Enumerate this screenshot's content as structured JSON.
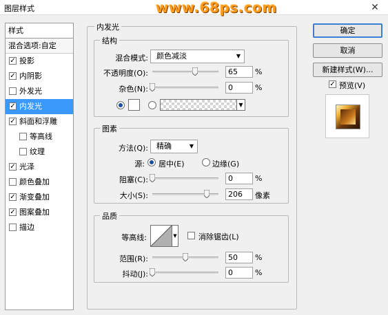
{
  "window": {
    "title": "图层样式",
    "watermark": "www.68ps.com",
    "close_glyph": "✕"
  },
  "left_panel": {
    "header": "样式",
    "blend_options": "混合选项:自定",
    "items": [
      {
        "label": "投影",
        "checked": true,
        "indent": false,
        "selected": false
      },
      {
        "label": "内阴影",
        "checked": true,
        "indent": false,
        "selected": false
      },
      {
        "label": "外发光",
        "checked": false,
        "indent": false,
        "selected": false
      },
      {
        "label": "内发光",
        "checked": true,
        "indent": false,
        "selected": true
      },
      {
        "label": "斜面和浮雕",
        "checked": true,
        "indent": false,
        "selected": false
      },
      {
        "label": "等高线",
        "checked": false,
        "indent": true,
        "selected": false
      },
      {
        "label": "纹理",
        "checked": false,
        "indent": true,
        "selected": false
      },
      {
        "label": "光泽",
        "checked": true,
        "indent": false,
        "selected": false
      },
      {
        "label": "颜色叠加",
        "checked": false,
        "indent": false,
        "selected": false
      },
      {
        "label": "渐变叠加",
        "checked": true,
        "indent": false,
        "selected": false
      },
      {
        "label": "图案叠加",
        "checked": true,
        "indent": false,
        "selected": false
      },
      {
        "label": "描边",
        "checked": false,
        "indent": false,
        "selected": false
      }
    ],
    "check_glyph": "✓"
  },
  "main": {
    "section_title": "内发光",
    "structure": {
      "title": "结构",
      "blend_mode_label": "混合模式:",
      "blend_mode_value": "颜色减淡",
      "opacity_label": "不透明度(O):",
      "opacity_value": "65",
      "opacity_fraction": 0.65,
      "noise_label": "杂色(N):",
      "noise_value": "0",
      "noise_fraction": 0,
      "percent": "%"
    },
    "elements": {
      "title": "图素",
      "method_label": "方法(Q):",
      "method_value": "精确",
      "source_label": "源:",
      "source_center": "居中(E)",
      "source_edge": "边缘(G)",
      "choke_label": "阻塞(C):",
      "choke_value": "0",
      "choke_fraction": 0,
      "size_label": "大小(S):",
      "size_value": "206",
      "size_fraction": 0.825,
      "size_unit": "像素",
      "percent": "%"
    },
    "quality": {
      "title": "品质",
      "contour_label": "等高线:",
      "antialias_label": "消除锯齿(L)",
      "range_label": "范围(R):",
      "range_value": "50",
      "range_fraction": 0.5,
      "jitter_label": "抖动(J):",
      "jitter_value": "0",
      "jitter_fraction": 0,
      "percent": "%"
    }
  },
  "buttons": {
    "ok": "确定",
    "cancel": "取消",
    "new_style": "新建样式(W)...",
    "preview_label": "预览(V)"
  }
}
